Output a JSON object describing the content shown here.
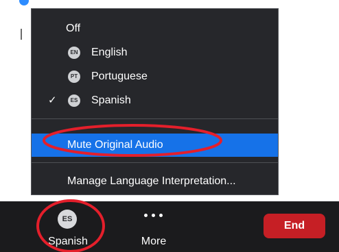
{
  "colors": {
    "menu_bg": "#26272b",
    "highlight": "#1672e8",
    "toolbar_bg": "#1b1b1d",
    "end_button": "#c61f25",
    "annotation": "#e41f2b"
  },
  "menu": {
    "items": [
      {
        "label": "Off",
        "badge": "",
        "checked": false
      },
      {
        "label": "English",
        "badge": "EN",
        "checked": false
      },
      {
        "label": "Portuguese",
        "badge": "PT",
        "checked": false
      },
      {
        "label": "Spanish",
        "badge": "ES",
        "checked": true
      }
    ],
    "check_glyph": "✓",
    "mute_label": "Mute Original Audio",
    "manage_label": "Manage Language Interpretation..."
  },
  "toolbar": {
    "language": {
      "badge": "ES",
      "label": "Spanish"
    },
    "more": {
      "label": "More",
      "icon": "more-dots-icon"
    },
    "end_label": "End"
  }
}
